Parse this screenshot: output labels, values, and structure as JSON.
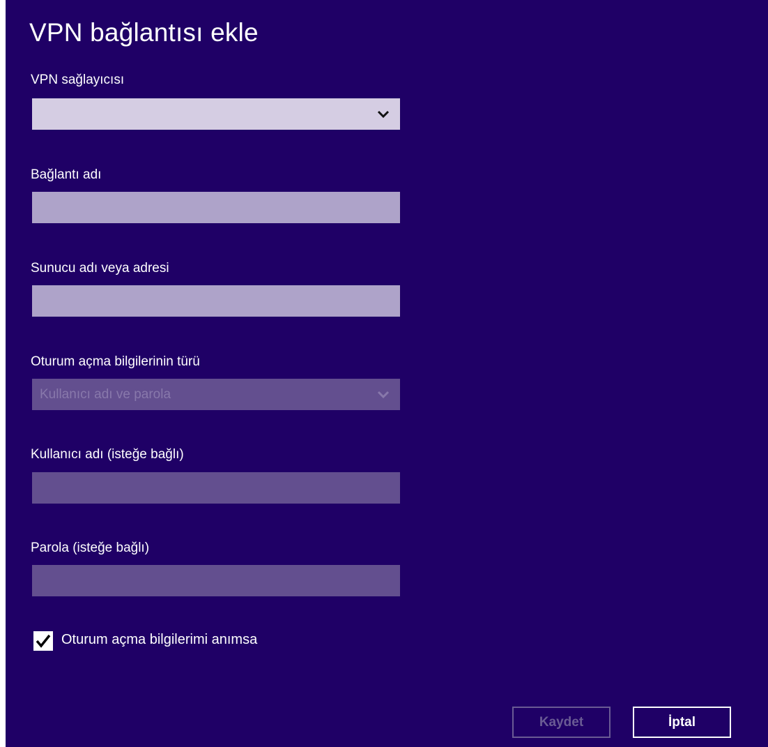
{
  "dialog": {
    "title": "VPN bağlantısı ekle"
  },
  "fields": {
    "vpn_provider": {
      "label": "VPN sağlayıcısı",
      "value": ""
    },
    "connection_name": {
      "label": "Bağlantı adı",
      "value": ""
    },
    "server": {
      "label": "Sunucu adı veya adresi",
      "value": ""
    },
    "sign_in_type": {
      "label": "Oturum açma bilgilerinin türü",
      "value": "Kullanıcı adı ve parola"
    },
    "username": {
      "label": "Kullanıcı adı (isteğe bağlı)",
      "value": ""
    },
    "password": {
      "label": "Parola (isteğe bağlı)",
      "value": ""
    }
  },
  "remember": {
    "label": "Oturum açma bilgilerimi anımsa",
    "checked": true
  },
  "buttons": {
    "save": "Kaydet",
    "cancel": "İptal"
  },
  "colors": {
    "background": "#1f0066",
    "select_enabled": "#d5cde3",
    "input_enabled": "#aea3c9",
    "field_disabled": "#634f8f",
    "button_disabled": "#6a5b94"
  }
}
